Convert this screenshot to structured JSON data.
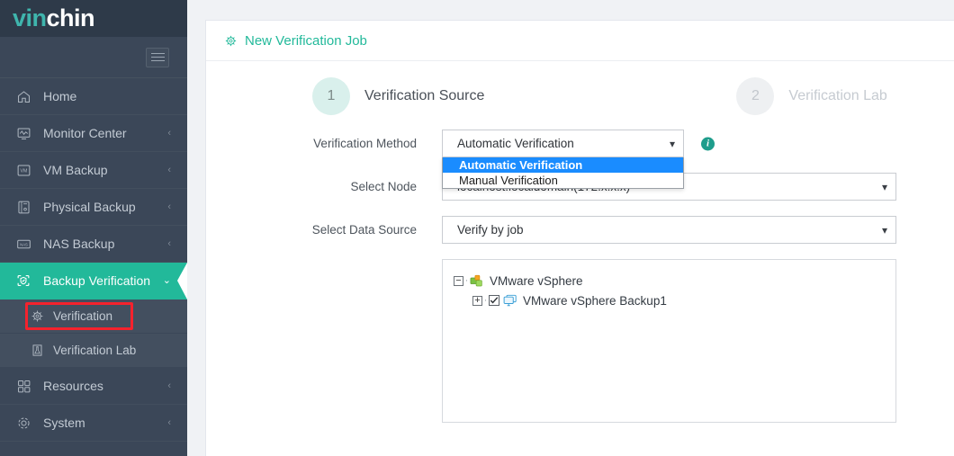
{
  "brand": {
    "part1": "vin",
    "part2": "chin",
    "accent": "#3fb5ad"
  },
  "sidebar": {
    "collapse_icon": "hamburger-icon",
    "items": [
      {
        "label": "Home",
        "icon": "home-icon",
        "chevron": "",
        "active": false
      },
      {
        "label": "Monitor Center",
        "icon": "monitor-icon",
        "chevron": "‹",
        "active": false
      },
      {
        "label": "VM Backup",
        "icon": "vm-icon",
        "chevron": "‹",
        "active": false
      },
      {
        "label": "Physical Backup",
        "icon": "server-icon",
        "chevron": "‹",
        "active": false
      },
      {
        "label": "NAS Backup",
        "icon": "nas-icon",
        "chevron": "‹",
        "active": false
      },
      {
        "label": "Backup Verification",
        "icon": "shield-check-icon",
        "chevron": "⌄",
        "active": true
      },
      {
        "label": "Resources",
        "icon": "grid-icon",
        "chevron": "‹",
        "active": false
      },
      {
        "label": "System",
        "icon": "gear-icon",
        "chevron": "‹",
        "active": false
      }
    ],
    "sub_items": [
      {
        "label": "Verification",
        "icon": "verification-icon",
        "highlighted": true
      },
      {
        "label": "Verification Lab",
        "icon": "lab-flask-icon",
        "highlighted": false
      }
    ],
    "highlight_color": "#f5222d",
    "active_color": "#22b99a"
  },
  "page": {
    "title": "New Verification Job",
    "title_icon": "verification-icon",
    "title_color": "#22b99a"
  },
  "steps": [
    {
      "number": "1",
      "label": "Verification Source",
      "state": "active"
    },
    {
      "number": "2",
      "label": "Verification Lab",
      "state": "inactive"
    }
  ],
  "form": {
    "verification_method": {
      "label": "Verification Method",
      "value": "Automatic Verification",
      "caret_icon": "chevron-down-icon",
      "info_icon": "info-icon",
      "options": [
        {
          "label": "Automatic Verification",
          "selected": true
        },
        {
          "label": "Manual Verification",
          "selected": false
        }
      ]
    },
    "select_node": {
      "label": "Select Node",
      "value": "localhost.localdomain(172.x.x.x)",
      "caret_icon": "chevron-down-icon"
    },
    "select_data_source": {
      "label": "Select Data Source",
      "value": "Verify by job",
      "caret_icon": "chevron-down-icon"
    }
  },
  "tree": {
    "nodes": [
      {
        "label": "VMware vSphere",
        "expander": "−",
        "icon": "vsphere-icon",
        "has_checkbox": false,
        "child": false
      },
      {
        "label": "VMware vSphere Backup1",
        "expander": "+",
        "icon": "vm-monitor-icon",
        "has_checkbox": true,
        "checked": true,
        "child": true
      }
    ]
  }
}
